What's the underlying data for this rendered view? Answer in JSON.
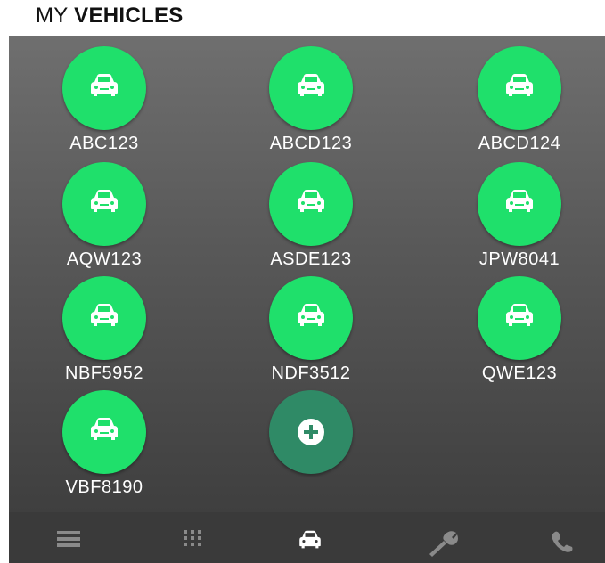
{
  "header": {
    "title_prefix": "MY ",
    "title_bold": "VEHICLES"
  },
  "vehicles": [
    "ABC123",
    "ABCD123",
    "ABCD124",
    "AQW123",
    "ASDE123",
    "JPW8041",
    "NBF5952",
    "NDF3512",
    "QWE123",
    "VBF8190"
  ],
  "icons": {
    "vehicle": "car-icon",
    "add": "plus-circle-icon",
    "tabs": [
      "list-icon",
      "grid-icon",
      "car-icon",
      "wrench-icon",
      "phone-icon"
    ]
  },
  "colors": {
    "vehicle_circle": "#1fe06b",
    "add_circle": "#2f8a66",
    "tab_active": "#ffffff",
    "tab_inactive": "#8a8a8a"
  },
  "tabs": {
    "active_index": 2
  }
}
